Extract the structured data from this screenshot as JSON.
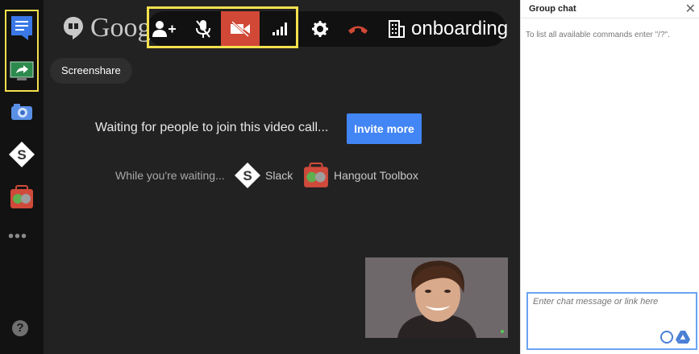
{
  "brand": {
    "text": "Google"
  },
  "toolbar": {
    "meeting_name": "onboarding"
  },
  "screenshare": {
    "label": "Screenshare"
  },
  "main": {
    "waiting_text": "Waiting for people to join this video call...",
    "invite_label": "Invite more",
    "while_waiting": "While you're waiting...",
    "apps": [
      {
        "label": "Slack"
      },
      {
        "label": "Hangout Toolbox"
      }
    ]
  },
  "chat": {
    "title": "Group chat",
    "hint": "To list all available commands enter \"/?\".",
    "placeholder": "Enter chat message or link here"
  },
  "colors": {
    "highlight": "#f4e04d",
    "invite_button": "#4285f4",
    "video_off": "#d14836",
    "hangup": "#d14836"
  }
}
